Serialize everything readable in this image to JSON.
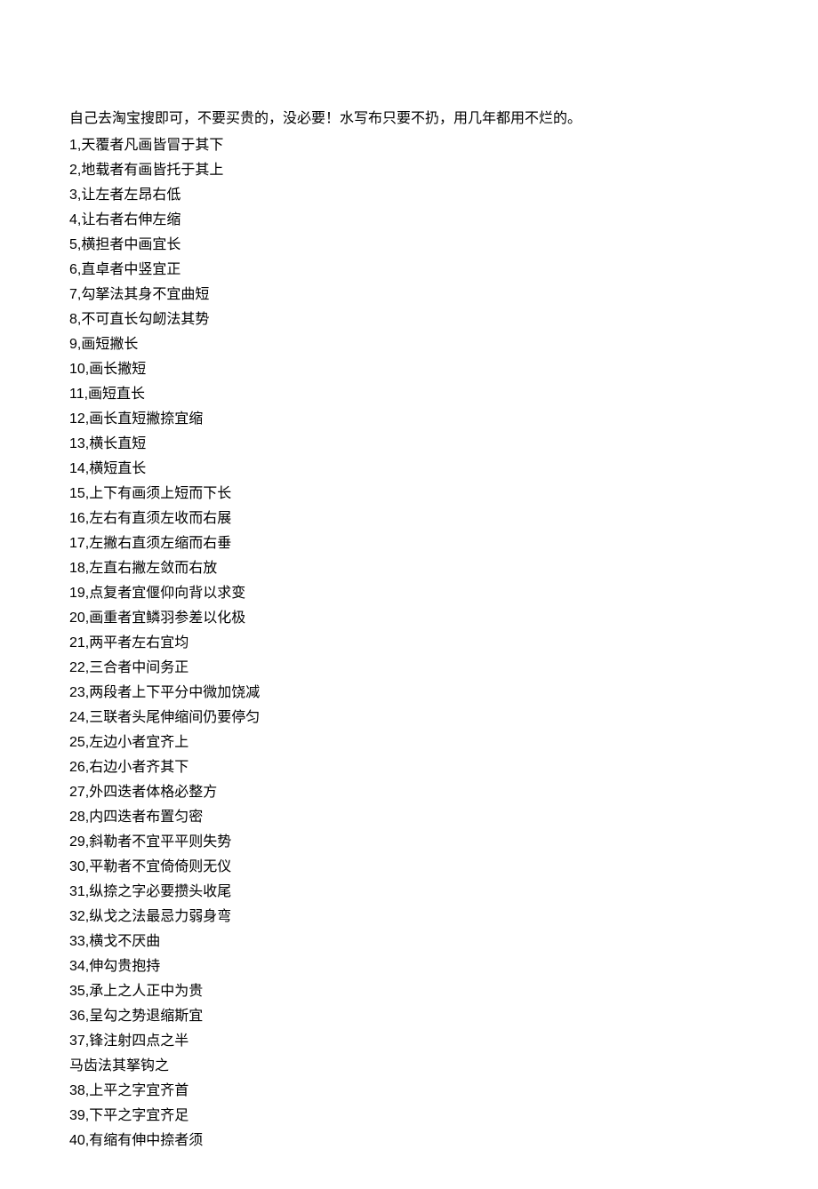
{
  "intro": "自己去淘宝搜即可，不要买贵的，没必要！水写布只要不扔，用几年都用不烂的。",
  "items": [
    "1,天覆者凡画皆冒于其下",
    "2,地载者有画皆托于其上",
    "3,让左者左昂右低",
    "4,让右者右伸左缩",
    "5,横担者中画宜长",
    "6,直卓者中竖宜正",
    "7,勾拏法其身不宜曲短",
    "8,不可直长勾衂法其势",
    "9,画短撇长",
    "10,画长撇短",
    "11,画短直长",
    "12,画长直短撇捺宜缩",
    "13,横长直短",
    "14,横短直长",
    "15,上下有画须上短而下长",
    "16,左右有直须左收而右展",
    "17,左撇右直须左缩而右垂",
    "18,左直右撇左敛而右放",
    "19,点复者宜偃仰向背以求变",
    "20,画重者宜鳞羽参差以化极",
    "21,两平者左右宜均",
    "22,三合者中间务正",
    "23,两段者上下平分中微加饶减",
    "24,三联者头尾伸缩间仍要停匀",
    "25,左边小者宜齐上",
    "26,右边小者齐其下",
    "27,外四迭者体格必整方",
    "28,内四迭者布置匀密",
    "29,斜勒者不宜平平则失势",
    "30,平勒者不宜倚倚则无仪",
    "31,纵捺之字必要攒头收尾",
    "32,纵戈之法最忌力弱身弯",
    "33,横戈不厌曲",
    "34,伸勾贵抱持",
    "35,承上之人正中为贵",
    "36,呈勾之势退缩斯宜",
    "37,锋注射四点之半",
    "马齿法其拏钩之",
    "38,上平之字宜齐首",
    "39,下平之字宜齐足",
    "40,有缩有伸中捺者须"
  ]
}
